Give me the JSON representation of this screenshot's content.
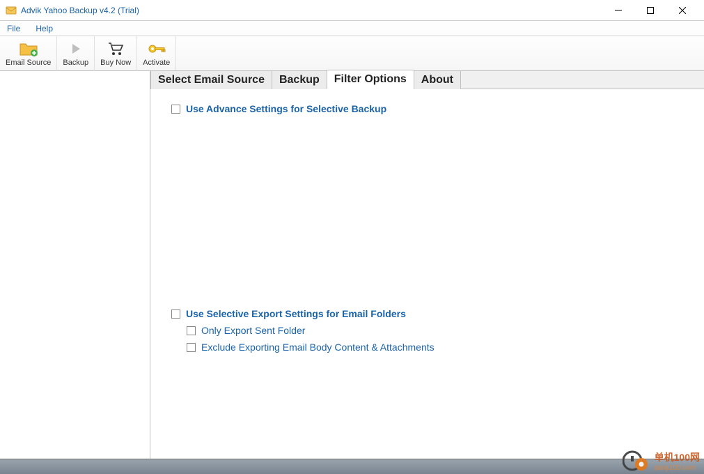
{
  "titlebar": {
    "title": "Advik Yahoo Backup v4.2 (Trial)"
  },
  "menubar": {
    "file": "File",
    "help": "Help"
  },
  "toolbar": {
    "email_source": "Email Source",
    "backup": "Backup",
    "buy_now": "Buy Now",
    "activate": "Activate"
  },
  "tabs": {
    "select_email_source": "Select Email Source",
    "backup": "Backup",
    "filter_options": "Filter Options",
    "about": "About"
  },
  "filter": {
    "advance_settings": "Use Advance Settings for Selective Backup",
    "selective_export": "Use Selective Export Settings for Email Folders",
    "only_sent": "Only Export Sent Folder",
    "exclude_body": "Exclude Exporting Email Body Content & Attachments"
  },
  "watermark": {
    "cn": "单机100网",
    "url": "danji100.com"
  }
}
